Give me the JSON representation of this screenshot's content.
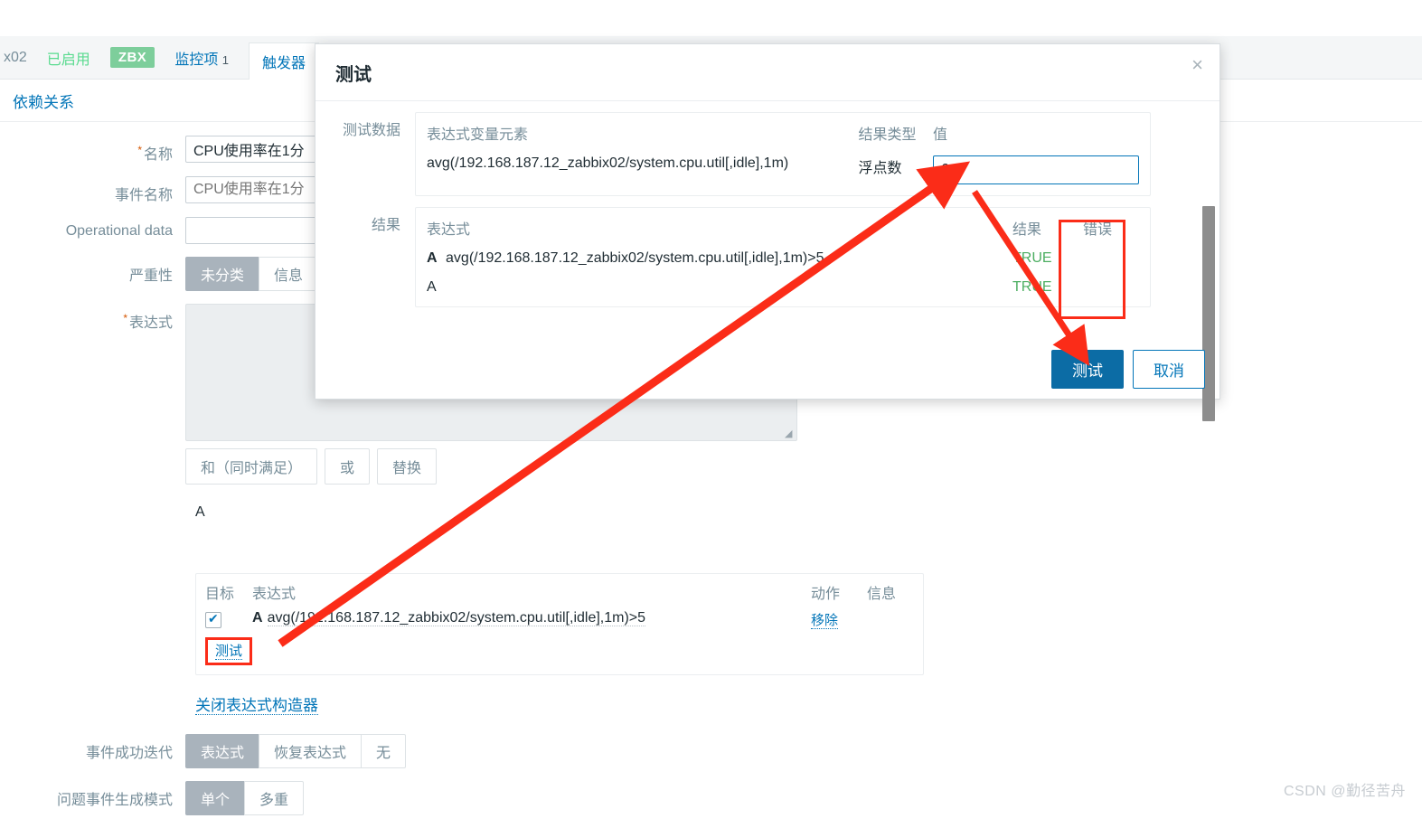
{
  "topbar": {
    "host_suffix": "x02",
    "status": "已启用",
    "agent_badge": "ZBX",
    "items_label": "监控项",
    "items_count": "1",
    "triggers_tab": "触发器"
  },
  "subbar": {
    "dependencies": "依赖关系"
  },
  "form": {
    "name_label": "名称",
    "name_value": "CPU使用率在1分",
    "event_name_label": "事件名称",
    "event_name_placeholder": "CPU使用率在1分",
    "operational_data_label": "Operational data",
    "operational_data_value": "",
    "severity_label": "严重性",
    "severity_options": [
      "未分类",
      "信息"
    ],
    "severity_selected": "未分类",
    "expression_label": "表达式",
    "expression_value": "",
    "expr_buttons": [
      "和（同时满足）",
      "或",
      "替换"
    ],
    "expr_letter": "A",
    "table": {
      "headers": {
        "target": "目标",
        "expression": "表达式",
        "action": "动作",
        "info": "信息"
      },
      "rows": [
        {
          "checked": true,
          "label": "A",
          "expression": "avg(/192.168.187.12_zabbix02/system.cpu.util[,idle],1m)>5",
          "action": "移除",
          "info": ""
        }
      ],
      "test_link": "测试"
    },
    "close_builder": "关闭表达式构造器",
    "recovery_label": "事件成功迭代",
    "recovery_options": [
      "表达式",
      "恢复表达式",
      "无"
    ],
    "recovery_selected": "表达式",
    "problem_mode_label": "问题事件生成模式",
    "problem_mode_options": [
      "单个",
      "多重"
    ],
    "problem_mode_selected": "单个"
  },
  "modal": {
    "title": "测试",
    "close_icon": "×",
    "test_data_label": "测试数据",
    "data_headers": {
      "expression_variable": "表达式变量元素",
      "result_type": "结果类型",
      "value": "值"
    },
    "data_row": {
      "expression_variable": "avg(/192.168.187.12_zabbix02/system.cpu.util[,idle],1m)",
      "result_type": "浮点数",
      "value": "6"
    },
    "result_label": "结果",
    "result_headers": {
      "expression": "表达式",
      "result": "结果",
      "error": "错误"
    },
    "result_rows": [
      {
        "label": "A",
        "expression": "avg(/192.168.187.12_zabbix02/system.cpu.util[,idle],1m)>5",
        "result": "TRUE",
        "error": ""
      },
      {
        "label": "",
        "expression": "A",
        "result": "TRUE",
        "error": ""
      }
    ],
    "buttons": {
      "test": "测试",
      "cancel": "取消"
    }
  },
  "watermark": "CSDN @勤径苦舟",
  "colors": {
    "accent": "#0275b8",
    "primary_button": "#0c6ca5",
    "annotation_red": "#fb2c18",
    "true_green": "#4cae61",
    "badge_green": "#7dce9b"
  }
}
